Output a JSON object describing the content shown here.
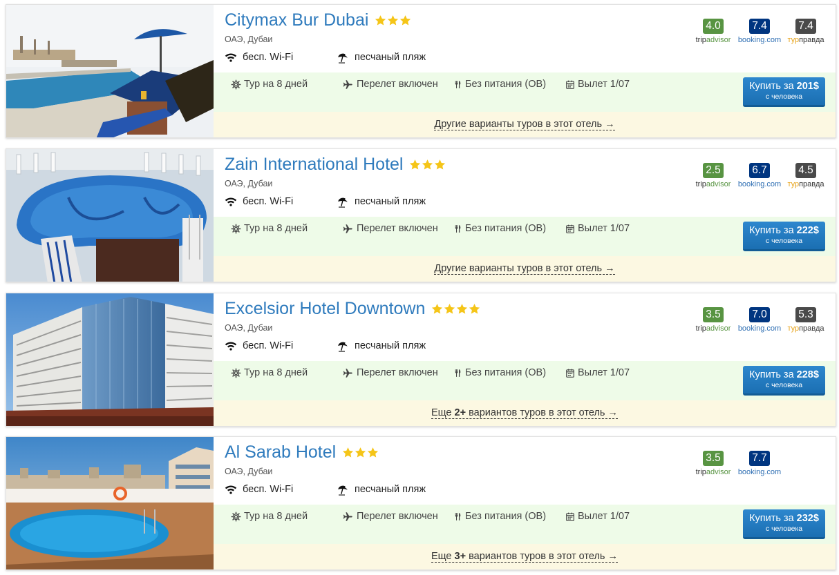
{
  "amenities": {
    "wifi": "бесп. Wi-Fi",
    "beach": "песчаный пляж"
  },
  "tour": {
    "duration": "Тур на 8 дней",
    "flight": "Перелет включен",
    "meals": "Без питания (ОВ)",
    "departure": "Вылет 1/07"
  },
  "buy": {
    "prefix": "Купить за",
    "per_person": "с человека"
  },
  "labels": {
    "trip_a": "trip",
    "trip_b": "advisor",
    "booking": "booking.com",
    "tp_a": "тур",
    "tp_b": "правда"
  },
  "colors": {
    "accent": "#2f7bbd",
    "tripadvisor": "#589442",
    "booking": "#003580",
    "turpravda": "#4a4a4a",
    "tour_bar": "#eefbe8",
    "more_bar": "#fcf8e2",
    "star": "#f5c518"
  },
  "hotels": [
    {
      "name": "Citymax Bur Dubai",
      "stars": 3,
      "location": "ОАЭ, Дубаи",
      "tripadvisor": "4.0",
      "booking": "7.4",
      "turpravda": "7.4",
      "price": "201$",
      "more_text": "Другие варианты туров в этот отель →"
    },
    {
      "name": "Zain International Hotel",
      "stars": 3,
      "location": "ОАЭ, Дубаи",
      "tripadvisor": "2.5",
      "booking": "6.7",
      "turpravda": "4.5",
      "price": "222$",
      "more_text": "Другие варианты туров в этот отель →"
    },
    {
      "name": "Excelsior Hotel Downtown",
      "stars": 4,
      "location": "ОАЭ, Дубаи",
      "tripadvisor": "3.5",
      "booking": "7.0",
      "turpravda": "5.3",
      "price": "228$",
      "more_pre": "Еще ",
      "more_bold": "2+",
      "more_post": " вариантов туров в этот отель →"
    },
    {
      "name": "Al Sarab Hotel",
      "stars": 3,
      "location": "ОАЭ, Дубаи",
      "tripadvisor": "3.5",
      "booking": "7.7",
      "price": "232$",
      "more_pre": "Еще ",
      "more_bold": "3+",
      "more_post": " вариантов туров в этот отель →"
    }
  ]
}
